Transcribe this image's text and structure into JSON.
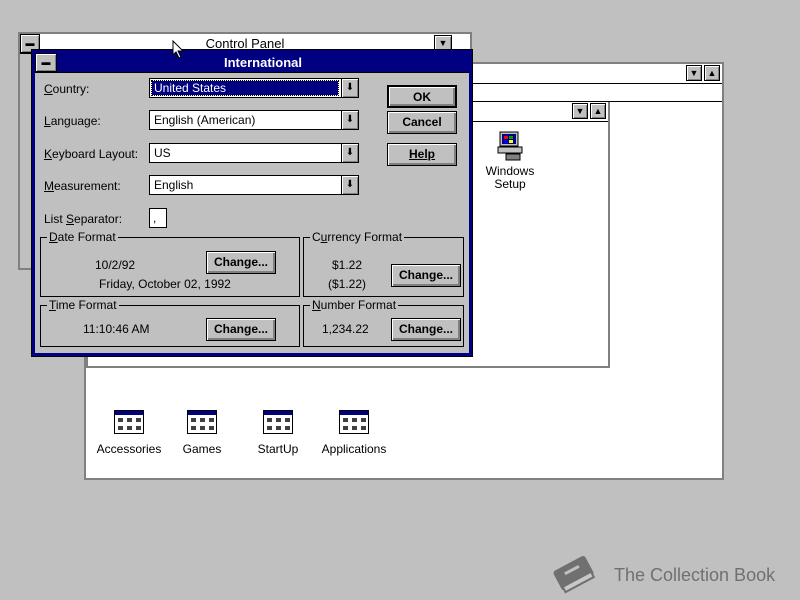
{
  "program_manager": {
    "title": "Control Panel"
  },
  "group_window": {
    "icons": [
      {
        "label": "Accessories"
      },
      {
        "label": "Games"
      },
      {
        "label": "StartUp"
      },
      {
        "label": "Applications"
      }
    ]
  },
  "main_group": {
    "windows_setup_label_1": "Windows",
    "windows_setup_label_2": "Setup"
  },
  "dialog": {
    "title": "International",
    "fields": {
      "country": {
        "label_pre": "",
        "label_u": "C",
        "label_post": "ountry:",
        "value": "United States"
      },
      "language": {
        "label_pre": "",
        "label_u": "L",
        "label_post": "anguage:",
        "value": "English (American)"
      },
      "keyboard": {
        "label_pre": "",
        "label_u": "K",
        "label_post": "eyboard Layout:",
        "value": "US"
      },
      "measurement": {
        "label_pre": "",
        "label_u": "M",
        "label_post": "easurement:",
        "value": "English"
      },
      "list_separator": {
        "label_pre": "List ",
        "label_u": "S",
        "label_post": "eparator:",
        "value": ","
      }
    },
    "buttons": {
      "ok": "OK",
      "cancel": "Cancel",
      "help": "Help"
    },
    "date_format": {
      "legend_u": "D",
      "legend_post": "ate Format",
      "short": "10/2/92",
      "long": "Friday, October 02, 1992",
      "change": "Change..."
    },
    "currency_format": {
      "legend_pre": "C",
      "legend_u": "u",
      "legend_post": "rrency Format",
      "positive": "$1.22",
      "negative": "($1.22)",
      "change": "Change..."
    },
    "time_format": {
      "legend_u": "T",
      "legend_post": "ime Format",
      "value": "11:10:46 AM",
      "change": "Change..."
    },
    "number_format": {
      "legend_u": "N",
      "legend_post": "umber Format",
      "value": "1,234.22",
      "change": "Change..."
    }
  },
  "watermark": {
    "text": "The Collection Book"
  }
}
